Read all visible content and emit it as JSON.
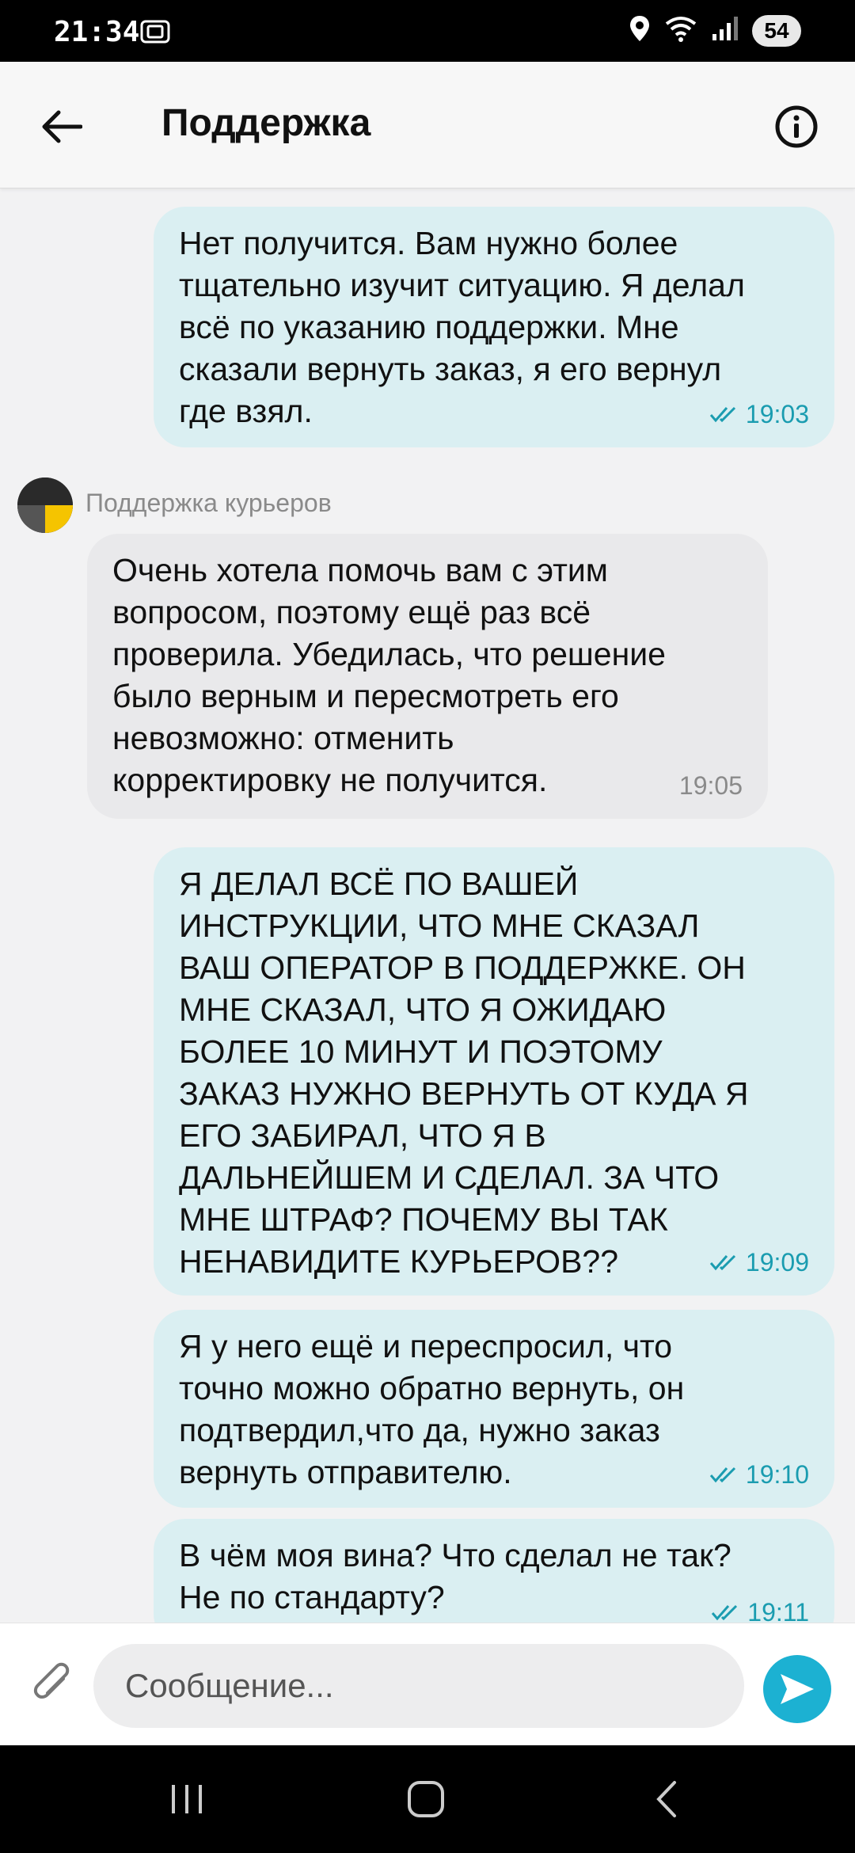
{
  "status_bar": {
    "time": "21:34",
    "battery": "54",
    "icons": [
      "screenshot-icon",
      "location-icon",
      "wifi-icon",
      "signal-icon"
    ]
  },
  "app_bar": {
    "title": "Поддержка",
    "back_icon": "arrow-left-icon",
    "info_icon": "info-icon"
  },
  "chat": {
    "incoming_sender": "Поддержка курьеров",
    "messages": [
      {
        "direction": "outgoing",
        "text": "Нет получится. Вам нужно более\nтщательно изучит ситуацию. Я делал\nвсё по указанию поддержки. Мне\nсказали вернуть заказ, я его вернул\nгде взял.",
        "time": "19:03",
        "status": "read"
      },
      {
        "direction": "incoming",
        "text": "Очень хотела помочь вам с этим\nвопросом, поэтому ещё раз всё\nпроверила. Убедилась, что решение\nбыло верным и пересмотреть его\nневозможно: отменить\nкорректировку не получится.",
        "time": "19:05"
      },
      {
        "direction": "outgoing",
        "text": "Я ДЕЛАЛ ВСЁ ПО ВАШЕЙ\nИНСТРУКЦИИ, ЧТО МНЕ СКАЗАЛ\nВАШ ОПЕРАТОР В ПОДДЕРЖКЕ. ОН\nМНЕ СКАЗАЛ, ЧТО Я ОЖИДАЮ\nБОЛЕЕ 10 МИНУТ И ПОЭТОМУ\nЗАКАЗ НУЖНО ВЕРНУТЬ ОТ КУДА Я\nЕГО ЗАБИРАЛ, ЧТО Я В\nДАЛЬНЕЙШЕМ И СДЕЛАЛ. ЗА ЧТО\nМНЕ ШТРАФ? ПОЧЕМУ ВЫ ТАК\nНЕНАВИДИТЕ КУРЬЕРОВ??",
        "time": "19:09",
        "status": "read"
      },
      {
        "direction": "outgoing",
        "text": "Я у него ещё и переспросил, что\nточно можно обратно вернуть, он\nподтвердил,что да, нужно заказ\nвернуть отправителю.",
        "time": "19:10",
        "status": "read"
      },
      {
        "direction": "outgoing",
        "text": "В чём моя вина? Что сделал не так?\nНе по стандарту?",
        "time": "19:11",
        "status": "read"
      }
    ]
  },
  "composer": {
    "placeholder": "Сообщение...",
    "attach_icon": "paperclip-icon",
    "send_icon": "send-icon"
  },
  "nav_bar": {
    "icons": [
      "recent-apps-icon",
      "home-icon",
      "back-icon"
    ]
  },
  "colors": {
    "outgoing_bubble": "#daeff2",
    "incoming_bubble": "#e9e9eb",
    "accent": "#1cb1d2",
    "read_time": "#1a9cb0"
  }
}
